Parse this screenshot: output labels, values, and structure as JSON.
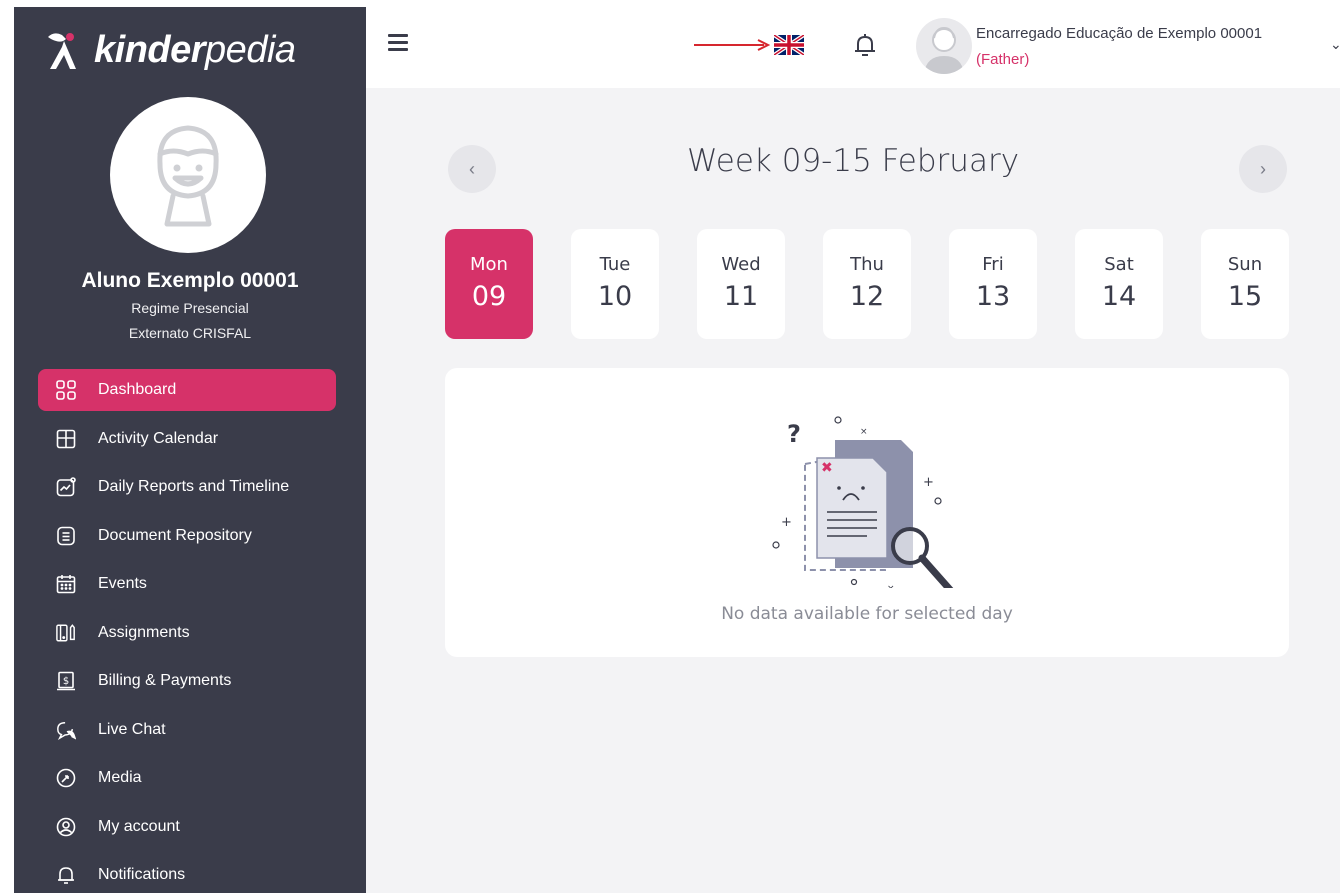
{
  "app": {
    "logo_bold": "kinder",
    "logo_light": "pedia"
  },
  "student": {
    "name": "Aluno Exemplo 00001",
    "regime": "Regime Presencial",
    "school": "Externato CRISFAL"
  },
  "sidebar": {
    "items": [
      {
        "label": "Dashboard",
        "icon": "dashboard-grid-icon",
        "active": true
      },
      {
        "label": "Activity Calendar",
        "icon": "calendar-grid-icon"
      },
      {
        "label": "Daily Reports and Timeline",
        "icon": "chart-timeline-icon"
      },
      {
        "label": "Document Repository",
        "icon": "document-icon"
      },
      {
        "label": "Events",
        "icon": "events-calendar-icon"
      },
      {
        "label": "Assignments",
        "icon": "assignments-icon"
      },
      {
        "label": "Billing & Payments",
        "icon": "billing-icon"
      },
      {
        "label": "Live Chat",
        "icon": "chat-icon"
      },
      {
        "label": "Media",
        "icon": "media-icon"
      },
      {
        "label": "My account",
        "icon": "account-icon"
      },
      {
        "label": "Notifications",
        "icon": "bell-icon"
      }
    ]
  },
  "header": {
    "user_name": "Encarregado Educação de Exemplo 00001",
    "user_role": "(Father)",
    "language": "uk-flag-icon"
  },
  "calendar": {
    "week_title": "Week 09-15 February",
    "days": [
      {
        "name": "Mon",
        "num": "09",
        "active": true
      },
      {
        "name": "Tue",
        "num": "10"
      },
      {
        "name": "Wed",
        "num": "11"
      },
      {
        "name": "Thu",
        "num": "12"
      },
      {
        "name": "Fri",
        "num": "13"
      },
      {
        "name": "Sat",
        "num": "14"
      },
      {
        "name": "Sun",
        "num": "15"
      }
    ],
    "prev_label": "‹",
    "next_label": "›"
  },
  "empty_state": {
    "message": "No data available for selected day"
  },
  "colors": {
    "accent": "#d63269",
    "sidebar": "#3a3c4a",
    "background": "#f3f3f5"
  }
}
